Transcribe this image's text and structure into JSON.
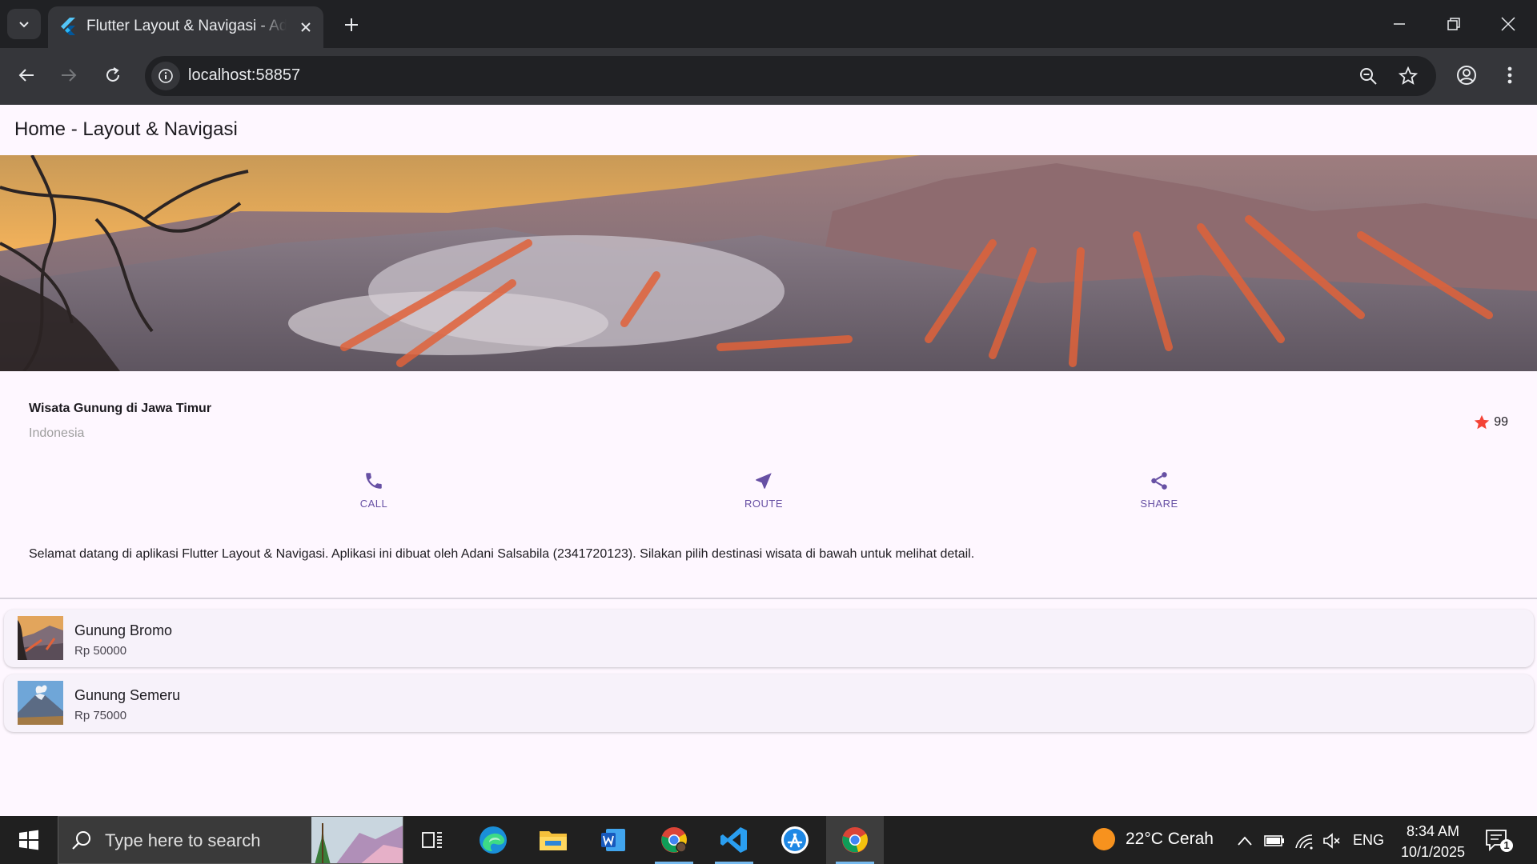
{
  "browser": {
    "tab_title": "Flutter Layout & Navigasi - Adani Salsabila",
    "url": "localhost:58857"
  },
  "app": {
    "title": "Home - Layout & Navigasi",
    "place_title": "Wisata Gunung di Jawa Timur",
    "location": "Indonesia",
    "rating_count": "99",
    "actions": [
      {
        "label": "CALL",
        "icon": "phone-icon"
      },
      {
        "label": "ROUTE",
        "icon": "near-me-icon"
      },
      {
        "label": "SHARE",
        "icon": "share-icon"
      }
    ],
    "description": "Selamat datang di aplikasi Flutter Layout & Navigasi. Aplikasi ini dibuat oleh Adani Salsabila (2341720123). Silakan pilih destinasi wisata di bawah untuk melihat detail.",
    "destinations": [
      {
        "name": "Gunung Bromo",
        "price": "Rp 50000"
      },
      {
        "name": "Gunung Semeru",
        "price": "Rp 75000"
      }
    ],
    "accent_color": "#6750a4",
    "star_color": "#f44336"
  },
  "taskbar": {
    "search_placeholder": "Type here to search",
    "weather": "22°C  Cerah",
    "language": "ENG",
    "time": "8:34 AM",
    "date": "10/1/2025",
    "notification_count": "1"
  }
}
